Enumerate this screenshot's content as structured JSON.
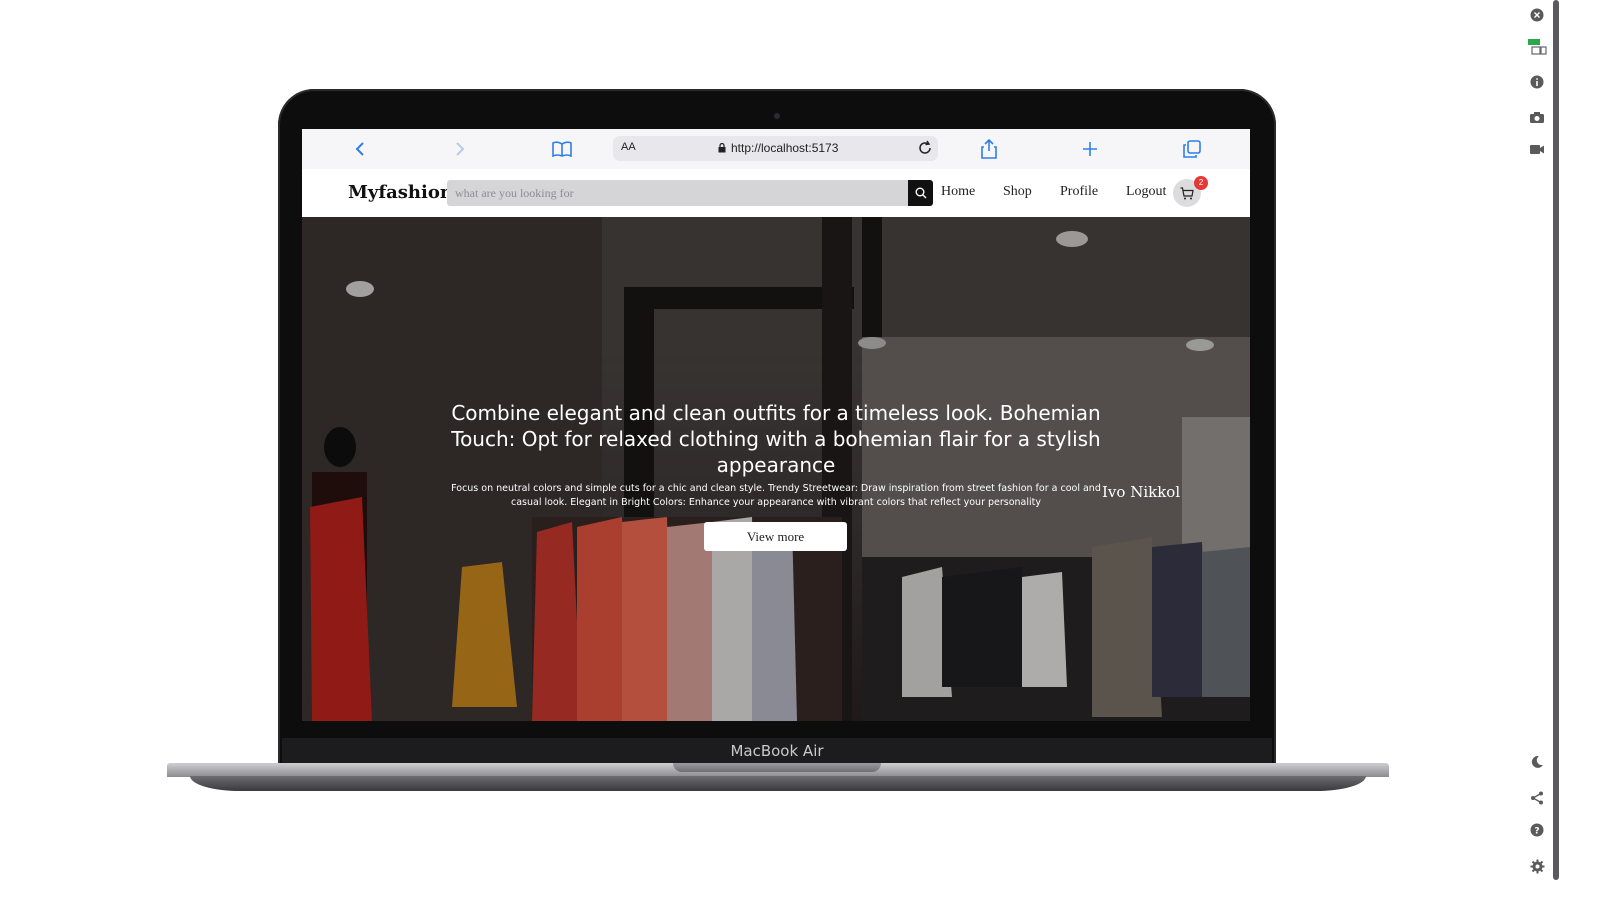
{
  "device": {
    "label": "MacBook Air"
  },
  "browser": {
    "reader_text": "AA",
    "url": "http://localhost:5173"
  },
  "site": {
    "logo": "Myfashion",
    "search": {
      "placeholder": "what are you looking for",
      "value": ""
    },
    "nav": [
      {
        "label": "Home"
      },
      {
        "label": "Shop"
      },
      {
        "label": "Profile"
      },
      {
        "label": "Logout"
      }
    ],
    "cart_count": "2"
  },
  "hero": {
    "title": "Combine elegant and clean outfits for a timeless look. Bohemian Touch: Opt for relaxed clothing with a bohemian flair for a stylish appearance",
    "subtitle": "Focus on neutral colors and simple cuts for a chic and clean style. Trendy Streetwear: Draw inspiration from street fashion for a cool and casual look. Elegant in Bright Colors: Enhance your appearance with vibrant colors that reflect your personality",
    "button": "View more",
    "store_sign": "Ivo Nikkol"
  },
  "colors": {
    "badge": "#e53935",
    "accent": "#2f7ee8"
  },
  "sidebar_icons": [
    "close-icon",
    "responsive-icon",
    "info-icon",
    "camera-icon",
    "video-icon",
    "moon-icon",
    "share-icon",
    "help-icon",
    "settings-icon"
  ]
}
